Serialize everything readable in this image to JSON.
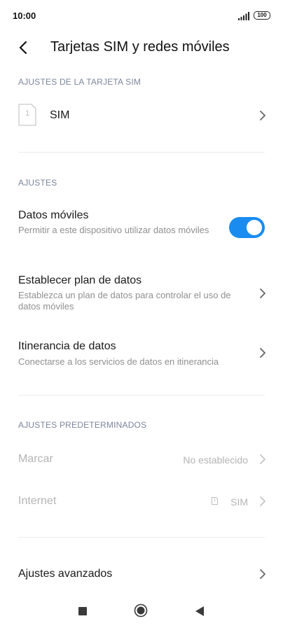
{
  "status_bar": {
    "time": "10:00",
    "battery": "100"
  },
  "header": {
    "title": "Tarjetas SIM y redes móviles"
  },
  "sim_section": {
    "label": "AJUSTES DE LA TARJETA SIM",
    "sim_slot_number": "1",
    "sim_name": "SIM"
  },
  "settings_section": {
    "label": "AJUSTES",
    "mobile_data": {
      "title": "Datos móviles",
      "subtitle": "Permitir a este dispositivo utilizar datos móviles",
      "enabled": true
    },
    "data_plan": {
      "title": "Establecer plan de datos",
      "subtitle": "Establezca un plan de datos para controlar el uso de datos móviles"
    },
    "roaming": {
      "title": "Itinerancia de datos",
      "subtitle": "Conectarse a los servicios de datos en itinerancia"
    }
  },
  "defaults_section": {
    "label": "AJUSTES PREDETERMINADOS",
    "dial": {
      "title": "Marcar",
      "value": "No establecido"
    },
    "internet": {
      "title": "Internet",
      "value": "SIM",
      "sim_slot_number": "1"
    }
  },
  "advanced": {
    "title": "Ajustes avanzados"
  },
  "colors": {
    "accent": "#1a8cf0",
    "section_label": "#7a8599",
    "disabled_text": "#b4b4b4"
  }
}
